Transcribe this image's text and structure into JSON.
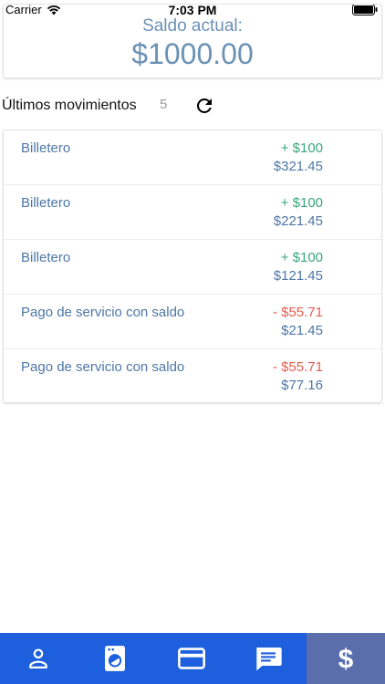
{
  "status_bar": {
    "carrier": "Carrier",
    "time": "7:03 PM"
  },
  "balance": {
    "label": "Saldo actual:",
    "amount": "$1000.00"
  },
  "movements": {
    "title": "Últimos movimientos",
    "count": "5",
    "items": [
      {
        "description": "Billetero",
        "amount": "+ $100",
        "balance": "$321.45",
        "type": "credit"
      },
      {
        "description": "Billetero",
        "amount": "+ $100",
        "balance": "$221.45",
        "type": "credit"
      },
      {
        "description": "Billetero",
        "amount": "+ $100",
        "balance": "$121.45",
        "type": "credit"
      },
      {
        "description": "Pago de servicio con saldo",
        "amount": "- $55.71",
        "balance": "$21.45",
        "type": "debit"
      },
      {
        "description": "Pago de servicio con saldo",
        "amount": "- $55.71",
        "balance": "$77.16",
        "type": "debit"
      }
    ]
  },
  "tab_bar": {
    "tabs": [
      {
        "icon": "person-icon"
      },
      {
        "icon": "washing-machine-icon"
      },
      {
        "icon": "credit-card-icon"
      },
      {
        "icon": "message-icon"
      },
      {
        "icon": "dollar-icon",
        "active": true
      }
    ]
  },
  "colors": {
    "credit": "#3aa57a",
    "debit": "#e0604f",
    "text_blue": "#4d77a6",
    "tab_bar": "#1d5fdc",
    "tab_active": "#5a6eac"
  }
}
